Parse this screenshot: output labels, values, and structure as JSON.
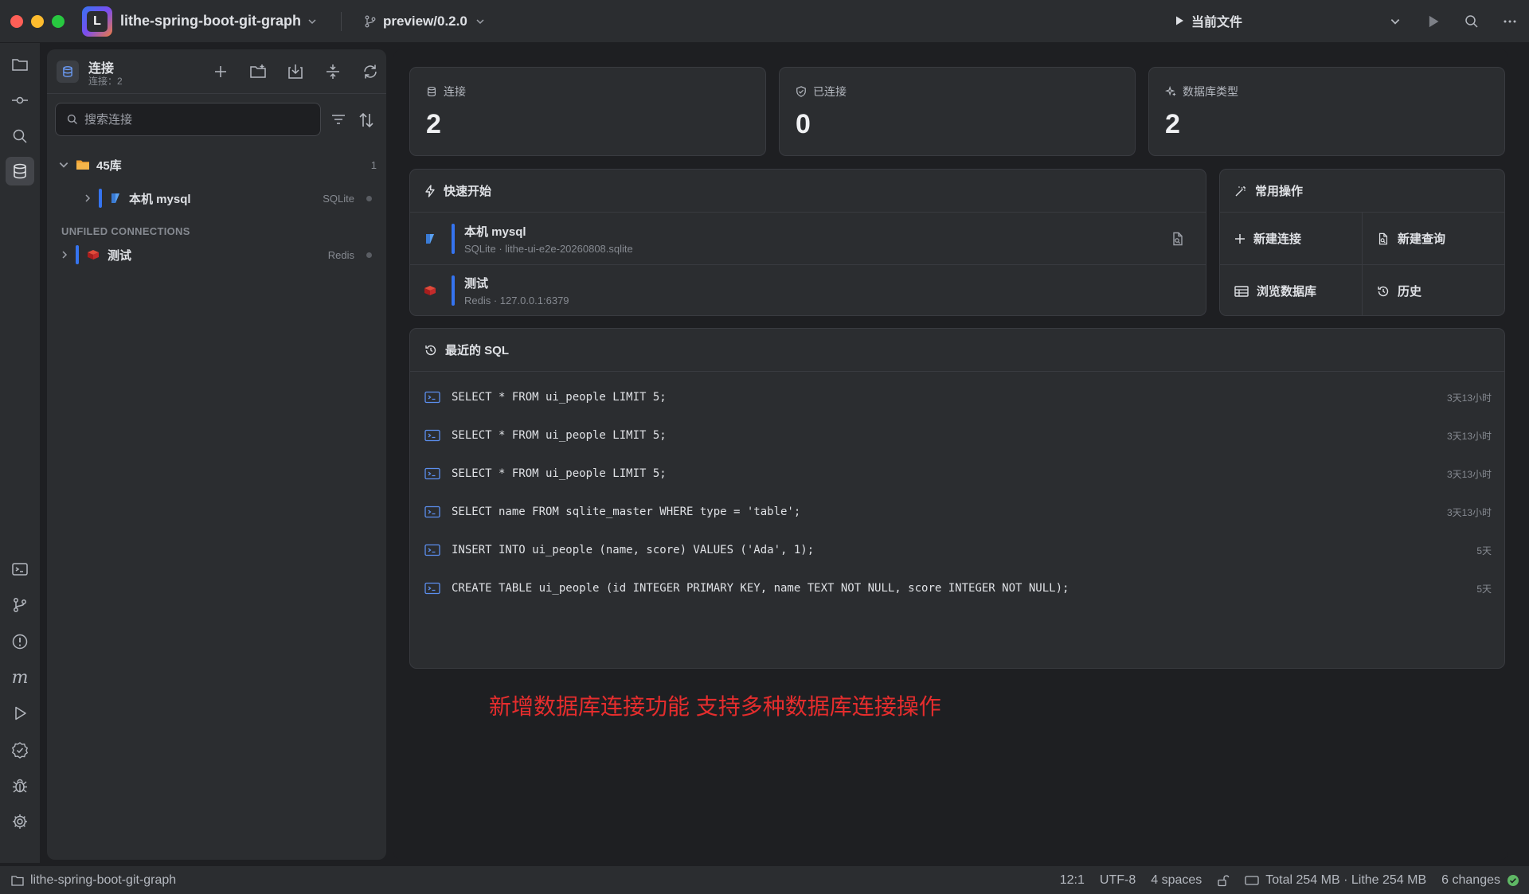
{
  "titlebar": {
    "project_name": "lithe-spring-boot-git-graph",
    "project_logo_letter": "L",
    "branch": "preview/0.2.0",
    "run_config": "当前文件"
  },
  "connections_panel": {
    "title": "连接",
    "subtitle": "连接：2",
    "search_placeholder": "搜索连接",
    "folder": {
      "name": "45库",
      "count": "1"
    },
    "folder_items": [
      {
        "name": "本机 mysql",
        "type": "SQLite"
      }
    ],
    "unfiled_title": "UNFILED CONNECTIONS",
    "unfiled_items": [
      {
        "name": "测试",
        "type": "Redis"
      }
    ]
  },
  "stats": [
    {
      "label": "连接",
      "value": "2",
      "icon": "database-icon"
    },
    {
      "label": "已连接",
      "value": "0",
      "icon": "shield-check-icon"
    },
    {
      "label": "数据库类型",
      "value": "2",
      "icon": "sparkle-icon"
    }
  ],
  "quick_start": {
    "title": "快速开始",
    "items": [
      {
        "name": "本机 mysql",
        "detail": "SQLite · lithe-ui-e2e-20260808.sqlite"
      },
      {
        "name": "测试",
        "detail": "Redis · 127.0.0.1:6379"
      }
    ]
  },
  "common_ops": {
    "title": "常用操作",
    "items": [
      {
        "label": "新建连接",
        "icon": "plus-icon"
      },
      {
        "label": "新建查询",
        "icon": "new-query-icon"
      },
      {
        "label": "浏览数据库",
        "icon": "table-icon"
      },
      {
        "label": "历史",
        "icon": "history-icon"
      }
    ]
  },
  "recent_sql": {
    "title": "最近的 SQL",
    "items": [
      {
        "sql": "SELECT * FROM ui_people LIMIT 5;",
        "time": "3天13小时"
      },
      {
        "sql": "SELECT * FROM ui_people LIMIT 5;",
        "time": "3天13小时"
      },
      {
        "sql": "SELECT * FROM ui_people LIMIT 5;",
        "time": "3天13小时"
      },
      {
        "sql": "SELECT name FROM sqlite_master WHERE type = 'table';",
        "time": "3天13小时"
      },
      {
        "sql": "INSERT INTO ui_people (name, score) VALUES ('Ada', 1);",
        "time": "5天"
      },
      {
        "sql": "CREATE TABLE ui_people (id INTEGER PRIMARY KEY, name TEXT NOT NULL, score INTEGER NOT NULL);",
        "time": "5天"
      }
    ]
  },
  "annotation": "新增数据库连接功能 支持多种数据库连接操作",
  "statusbar": {
    "project": "lithe-spring-boot-git-graph",
    "position": "12:1",
    "encoding": "UTF-8",
    "indent": "4 spaces",
    "memory": "Total 254 MB · Lithe 254 MB",
    "changes": "6 changes"
  },
  "colors": {
    "accent": "#3574f0",
    "annotation": "#e52d2d",
    "folder": "#f0a030",
    "redis": "#d42a2a",
    "success": "#5fb865"
  }
}
